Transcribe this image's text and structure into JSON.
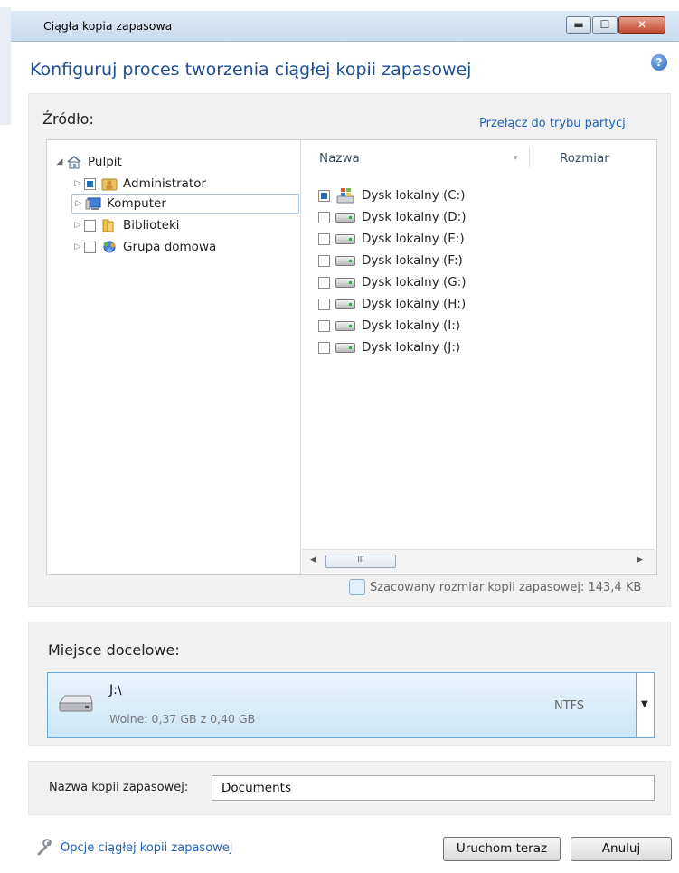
{
  "window": {
    "title": "Ciągła kopia zapasowa",
    "controls": {
      "minimize": "▬",
      "maximize": "☐",
      "close": "✕"
    }
  },
  "header": {
    "heading": "Konfiguruj proces tworzenia ciągłej kopii zapasowej",
    "help_icon": "?"
  },
  "source": {
    "label": "Źródło:",
    "switch_link": "Przełącz do trybu partycji",
    "tree": [
      {
        "label": "Pulpit",
        "icon": "home-icon",
        "expanded": true
      },
      {
        "label": "Administrator",
        "icon": "user-folder-icon",
        "checked": "partial"
      },
      {
        "label": "Komputer",
        "icon": "computer-icon",
        "selected": true
      },
      {
        "label": "Biblioteki",
        "icon": "folder-icon",
        "checked": false
      },
      {
        "label": "Grupa domowa",
        "icon": "homegroup-icon",
        "checked": false
      }
    ],
    "columns": {
      "name": "Nazwa",
      "size": "Rozmiar"
    },
    "drives": [
      {
        "label": "Dysk lokalny (C:)",
        "checked": "partial",
        "icon": "system-drive-icon"
      },
      {
        "label": "Dysk lokalny (D:)",
        "checked": false,
        "icon": "hard-drive-icon"
      },
      {
        "label": "Dysk lokalny (E:)",
        "checked": false,
        "icon": "hard-drive-icon"
      },
      {
        "label": "Dysk lokalny (F:)",
        "checked": false,
        "icon": "hard-drive-icon"
      },
      {
        "label": "Dysk lokalny (G:)",
        "checked": false,
        "icon": "hard-drive-icon"
      },
      {
        "label": "Dysk lokalny (H:)",
        "checked": false,
        "icon": "hard-drive-icon"
      },
      {
        "label": "Dysk lokalny (I:)",
        "checked": false,
        "icon": "hard-drive-icon"
      },
      {
        "label": "Dysk lokalny (J:)",
        "checked": false,
        "icon": "hard-drive-icon"
      }
    ],
    "scroll": {
      "left": "◀",
      "right": "▶",
      "grip": "III"
    },
    "estimate": "Szacowany rozmiar kopii zapasowej: 143,4 KB"
  },
  "destination": {
    "label": "Miejsce docelowe:",
    "path": "J:\\",
    "free": "Wolne: 0,37 GB z 0,40 GB",
    "filesystem": "NTFS",
    "dropdown_arrow": "▼"
  },
  "backup_name": {
    "label": "Nazwa kopii zapasowej:",
    "value": "Documents"
  },
  "footer": {
    "options_link": "Opcje ciągłej kopii zapasowej",
    "run_button": "Uruchom teraz",
    "cancel_button": "Anuluj"
  },
  "colors": {
    "accent": "#1e4f94",
    "link": "#1f63b8",
    "panel": "#f1f1f1"
  }
}
